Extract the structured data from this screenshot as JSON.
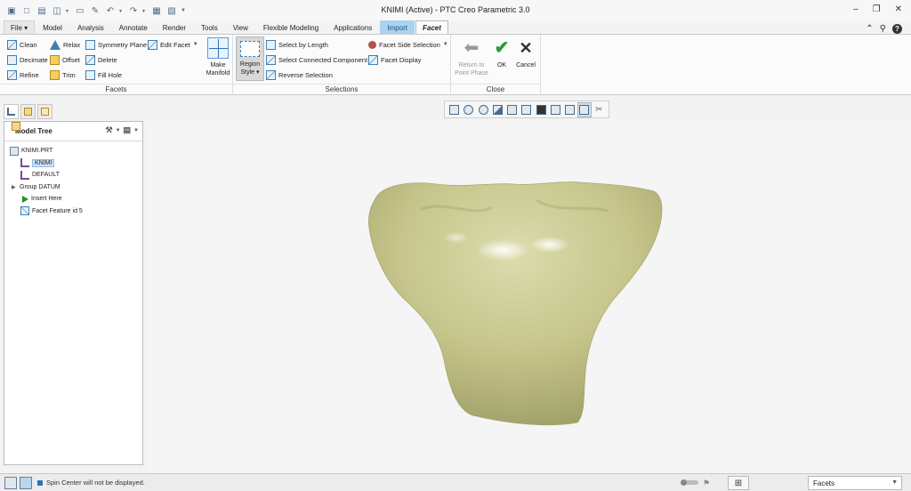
{
  "window": {
    "title": "KNIMI (Active) - PTC Creo Parametric 3.0"
  },
  "tabs": [
    {
      "label": "File ▾"
    },
    {
      "label": "Model"
    },
    {
      "label": "Analysis"
    },
    {
      "label": "Annotate"
    },
    {
      "label": "Render"
    },
    {
      "label": "Tools"
    },
    {
      "label": "View"
    },
    {
      "label": "Flexible Modeling"
    },
    {
      "label": "Applications"
    },
    {
      "label": "Import"
    },
    {
      "label": "Facet"
    }
  ],
  "ribbon": {
    "facets": {
      "label": "Facets",
      "clean": "Clean",
      "relax": "Relax",
      "symmetry_plane": "Symmetry Plane",
      "edit_facet": "Edit Facet",
      "decimate": "Decimate",
      "offset": "Offset",
      "delete": "Delete",
      "refine": "Refine",
      "trim": "Trim",
      "fill_hole": "Fill Hole",
      "make_manifold_1": "Make",
      "make_manifold_2": "Manifold"
    },
    "selections": {
      "label": "Selections",
      "region_style_1": "Region",
      "region_style_2": "Style ▾",
      "select_by_length": "Select by Length",
      "select_connected": "Select Connected Component",
      "reverse_selection": "Reverse Selection",
      "facet_side_selection": "Facet Side Selection",
      "facet_display": "Facet Display"
    },
    "close": {
      "label": "Close",
      "return_1": "Return to",
      "return_2": "Point Phase",
      "ok": "OK",
      "cancel": "Cancel"
    }
  },
  "panel": {
    "title": "Model Tree",
    "tree": [
      {
        "label": "KNIMI.PRT"
      },
      {
        "label": "KNIMI"
      },
      {
        "label": "DEFAULT"
      },
      {
        "label": "Group DATUM"
      },
      {
        "label": "Insert Here"
      },
      {
        "label": "Facet Feature id 5"
      }
    ]
  },
  "status": {
    "message": "Spin Center will not be displayed.",
    "filter": "Facets"
  },
  "colors": {
    "accent": "#3f7fb3",
    "import_tab": "#a9d3f0",
    "model_fill": "#c9c98f",
    "ok_green": "#2f9a3a"
  }
}
